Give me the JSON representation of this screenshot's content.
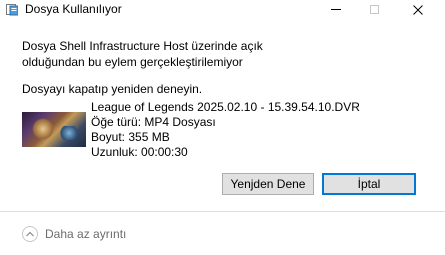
{
  "window": {
    "title": "Dosya Kullanılıyor",
    "icons": {
      "app": "document-icon",
      "minimize": "minimize-icon",
      "maximize": "maximize-icon",
      "close": "close-icon"
    }
  },
  "message": {
    "main": "Dosya Shell Infrastructure Host üzerinde açık olduğundan bu eylem gerçekleştirilemiyor",
    "hint": "Dosyayı kapatıp yeniden deneyin."
  },
  "file": {
    "name": "League of Legends 2025.02.10 - 15.39.54.10.DVR",
    "type": "Öğe türü: MP4 Dosyası",
    "size": "Boyut: 355 MB",
    "duration": "Uzunluk: 00:00:30"
  },
  "buttons": {
    "retry": "Yenjden Dene",
    "cancel": "İptal"
  },
  "footer": {
    "details_label": "Daha az ayrıntı",
    "icon": "chevron-up-icon"
  },
  "colors": {
    "focus_border": "#0078d7",
    "button_bg": "#e1e1e1",
    "muted_text": "#6d6d6d"
  }
}
